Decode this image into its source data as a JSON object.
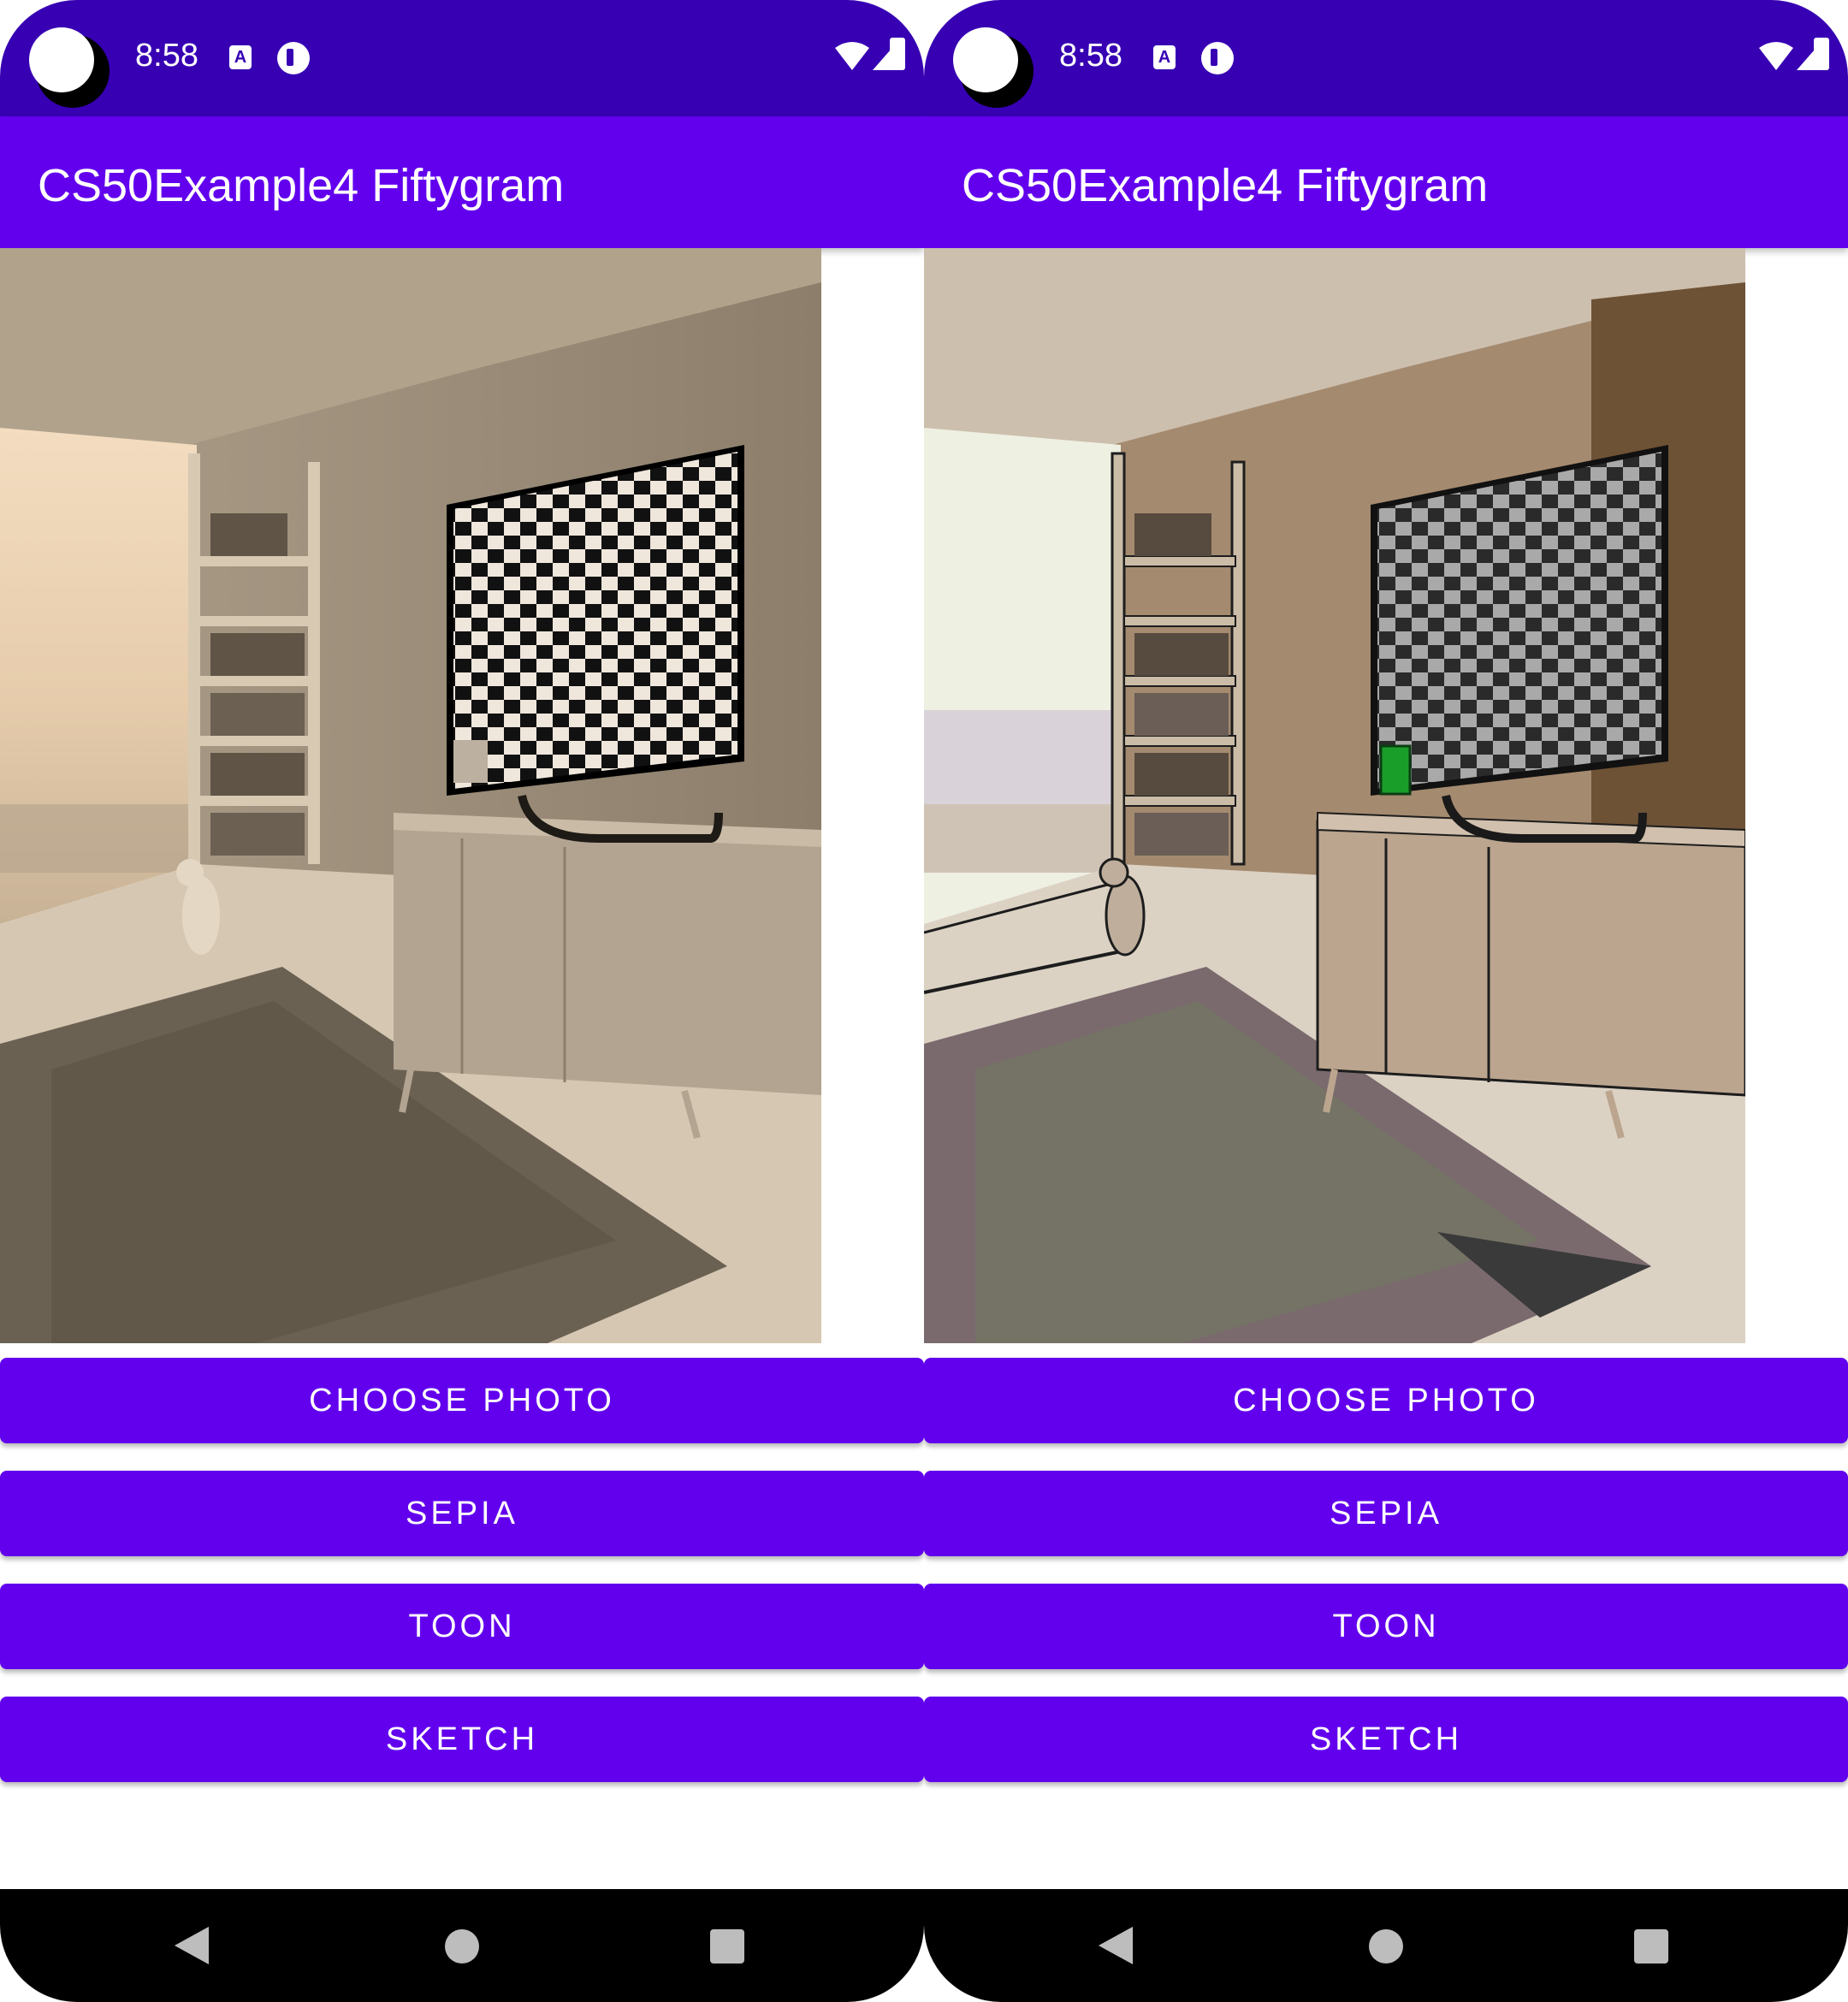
{
  "screens": [
    {
      "status": {
        "time": "8:58",
        "notif_a": "A"
      },
      "app_title": "CS50Example4 Fiftygram",
      "photo": {
        "filter": "sepia",
        "tv_marker_color": ""
      },
      "buttons": {
        "choose_photo": "CHOOSE PHOTO",
        "sepia": "SEPIA",
        "toon": "TOON",
        "sketch": "SKETCH"
      }
    },
    {
      "status": {
        "time": "8:58",
        "notif_a": "A"
      },
      "app_title": "CS50Example4 Fiftygram",
      "photo": {
        "filter": "toon",
        "tv_marker_color": "#1a9e2a"
      },
      "buttons": {
        "choose_photo": "CHOOSE PHOTO",
        "sepia": "SEPIA",
        "toon": "TOON",
        "sketch": "SKETCH"
      }
    }
  ],
  "colors": {
    "status_bar": "#3700b3",
    "primary": "#6200ee",
    "on_primary": "#ffffff",
    "nav_bar": "#000000"
  },
  "icons": {
    "status": [
      "wifi-icon",
      "cell-signal-icon",
      "battery-icon"
    ],
    "navigation": [
      "back-icon",
      "home-icon",
      "recents-icon"
    ]
  }
}
